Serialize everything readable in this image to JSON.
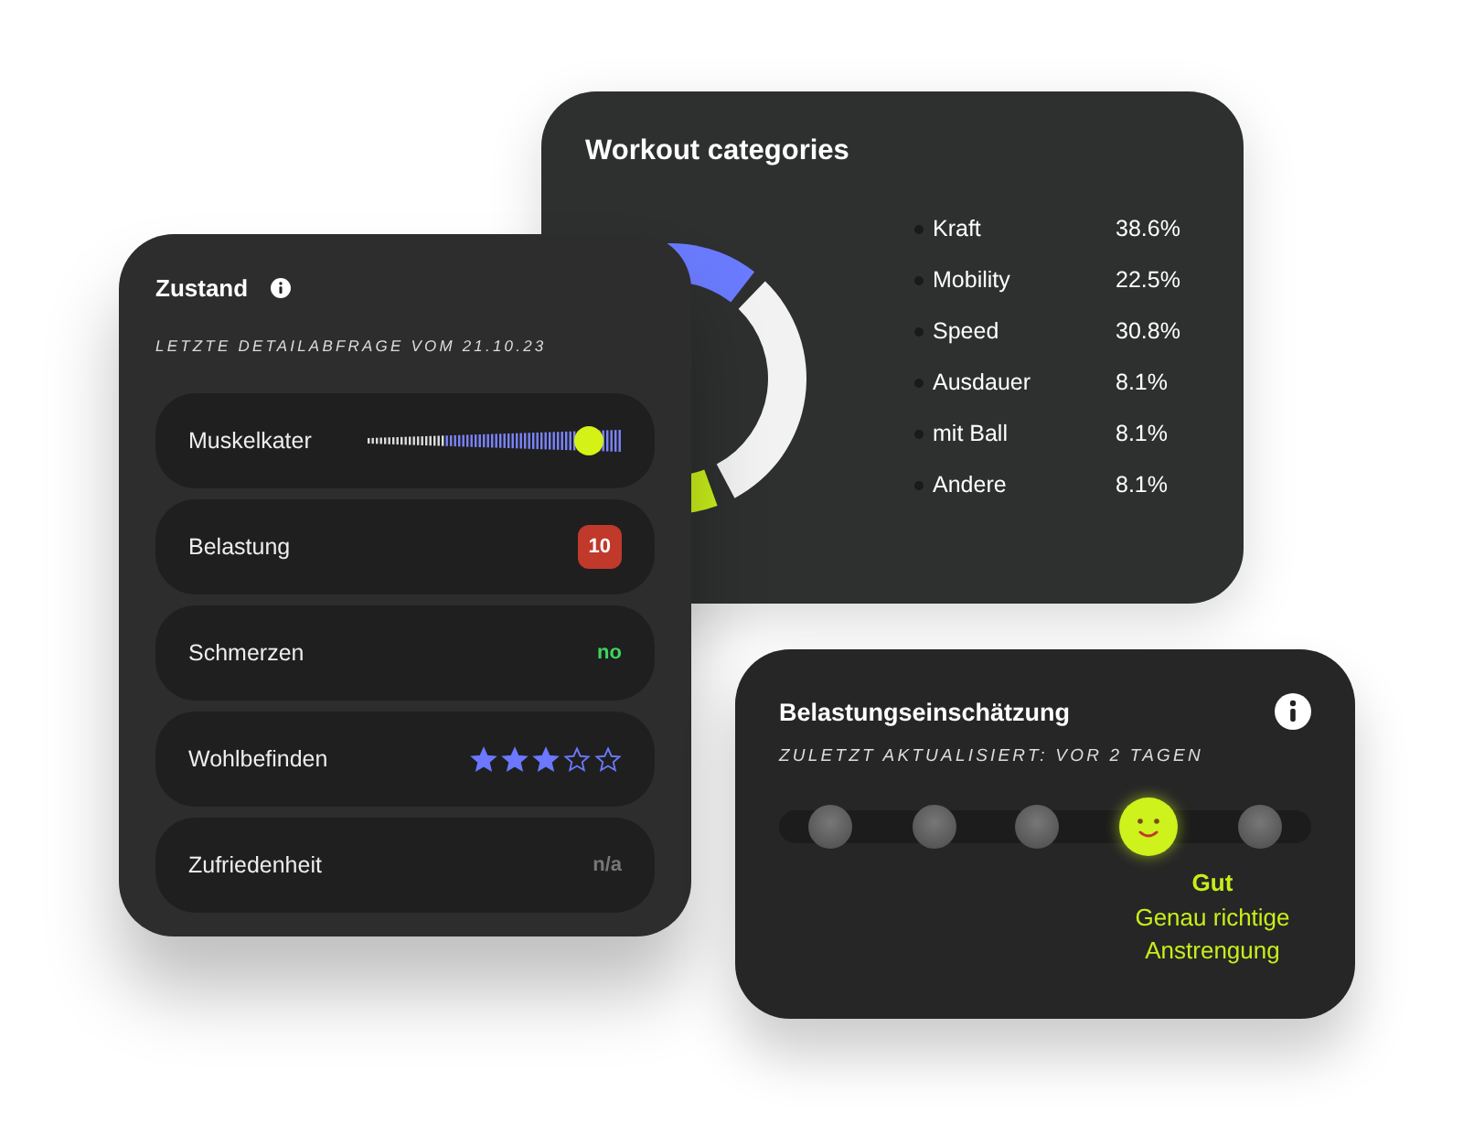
{
  "workout_categories": {
    "title": "Workout categories",
    "legend": [
      {
        "label": "Kraft",
        "value": "38.6%"
      },
      {
        "label": "Mobility",
        "value": "22.5%"
      },
      {
        "label": "Speed",
        "value": "30.8%"
      },
      {
        "label": "Ausdauer",
        "value": "8.1%"
      },
      {
        "label": "mit Ball",
        "value": "8.1%"
      },
      {
        "label": "Andere",
        "value": "8.1%"
      }
    ]
  },
  "zustand": {
    "title": "Zustand",
    "subtitle": "LETZTE DETAILABFRAGE VOM 21.10.23",
    "rows": [
      {
        "kind": "slider",
        "label": "Muskelkater",
        "level": 0.87
      },
      {
        "kind": "badge",
        "label": "Belastung",
        "value": "10"
      },
      {
        "kind": "status",
        "label": "Schmerzen",
        "value": "no"
      },
      {
        "kind": "stars",
        "label": "Wohlbefinden",
        "stars": 3
      },
      {
        "kind": "muted",
        "label": "Zufriedenheit",
        "value": "n/a"
      }
    ]
  },
  "belastung": {
    "title": "Belastungseinschätzung",
    "subtitle": "ZULETZT AKTUALISIERT: VOR 2 TAGEN",
    "scale": [
      {
        "selected": false
      },
      {
        "selected": false
      },
      {
        "selected": false
      },
      {
        "selected": true
      },
      {
        "selected": false
      }
    ],
    "rating": "Gut",
    "description": "Genau richtige Anstrengung"
  }
}
